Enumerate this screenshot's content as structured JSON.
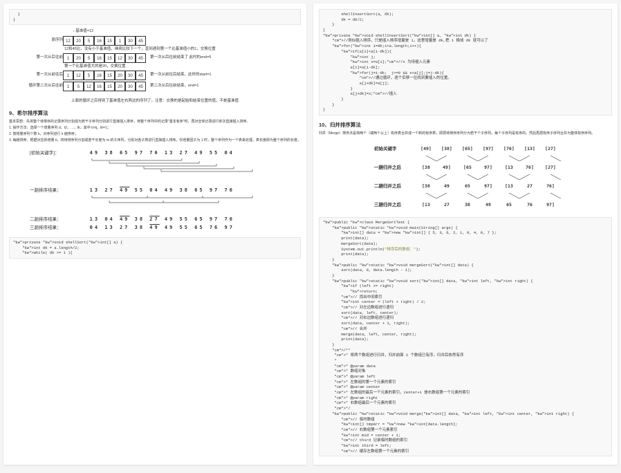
{
  "left_page": {
    "code_top": "  }\n}",
    "quicksort": {
      "pivot_label": "基准值=12",
      "rows": [
        {
          "label": "原序列",
          "cells": [
            "12",
            "20",
            "5",
            "16",
            "15",
            "1",
            "30",
            "45"
          ],
          "note": ""
        },
        {
          "desc": "12和45比，没有小于基准值，继续比较下一个，直到遇到第一个比基准值小的1，交换位置"
        },
        {
          "label": "第一次从后往前",
          "cells": [
            "1",
            "20",
            "5",
            "16",
            "15",
            "12",
            "30",
            "45"
          ],
          "note": "第一次从后往前结束了    此时的end=5"
        },
        {
          "desc": "第一个比基准值大的是20，交换位置"
        },
        {
          "label": "第一次从前往后",
          "cells": [
            "1",
            "12",
            "5",
            "16",
            "15",
            "20",
            "30",
            "45"
          ],
          "note": "第一次从前往后结束，此时的start=1"
        },
        {
          "label": "循环第二次从后往前",
          "cells": [
            "1",
            "5",
            "12",
            "16",
            "15",
            "20",
            "30",
            "45"
          ],
          "note": "第二次从后往前结束，end=1"
        }
      ],
      "summary": "上面的循环之后得到了基准值左右两边的序列了。注意：交换的是起始和结束位置的值，不是基准值"
    },
    "section9_title": "9、希尔排序算法",
    "section9_desc": "基本思想：先将整个待排序的记录序列分割成为若干子序列分别进行直接插入排序，待整个序列中的记录\"基本有序\"时，再对全体记录进行依次直接插入排序。",
    "section9_steps": [
      "1. 操作方法：选择一个增量序列 d，t2，…，tk，其中 ti>tj，tk=1；",
      "2. 按增量序列个数 k，对序列进行 k 趟排序；",
      "3. 每趟排序，根据对应的增量 ti，将待排序列分割成若干长度为 m 的子序列，分别对各子表进行直接插入排序。仅增量因子为 1 时，整个序列作为一个表来处理，表长度即为整个序列的长度。"
    ],
    "shell": {
      "init_label": "[初始关键字]：",
      "init": "49  38  65  97  76  13  27  49  55  04",
      "pass1_label": "一趟排序结果：",
      "pass1": "13  27  49  55  04  49  38  65  97  76",
      "pass2_label": "二趟排序结果：",
      "pass2": "13  04  49  38  27  49  55  65  97  76",
      "pass3_label": "三趟排序结果：",
      "pass3": "04  13  27  38  49  49  55  65  76  97"
    },
    "code_bottom_lines": [
      "private void shellSort(int[] a) {",
      "    int dk = a.length/2;",
      "    while( dk >= 1 ){"
    ]
  },
  "right_page": {
    "code_top_lines": [
      "        shellInsertSort(a, dk);",
      "        dk = dk/2;",
      "    }",
      "}",
      "private void shellInsertSort(int[] a, int dk) {",
      "    //类似插入排序，只是插入排序增量是 1，这里增量是 dk,把 1 换成 dk 就可以了",
      "    for(int i=dk;i<a.length;i++){",
      "        if(a[i]<a[i-dk]){",
      "            int j;",
      "            int x=a[i];//x 为待插入元素",
      "            a[i]=a[i-dk];",
      "            for(j=i-dk;  j>=0 && x<a[j];j=j-dk){",
      "                //通过循环，逐个后移一位找到要插入的位置。",
      "                a[j+dk]=a[j];",
      "            }",
      "            a[j+dk]=x;//插入",
      "        }",
      "    }",
      "}"
    ],
    "section10_title": "10、归并排序算法",
    "section10_desc": "归并（Merge）排序法是将两个（或两个以上）有序表合并成一个新的有序表，即把待排序序列分为若干个子序列，每个子序列是有序的。然后再把有序子序列合并为整体有序序列。",
    "merge": {
      "rows": [
        {
          "label": "初始关键字",
          "vals": [
            "[49]",
            "[38]",
            "[65]",
            "[97]",
            "[76]",
            "[13]",
            "[27]"
          ]
        },
        {
          "label": "一趟归并之后",
          "vals": [
            "[38",
            "49]",
            "[65",
            "97]",
            "[13",
            "76]",
            "[27]"
          ]
        },
        {
          "label": "二趟归并之后",
          "vals": [
            "[38",
            "49",
            "65",
            "97]",
            "[13",
            "27",
            "76]"
          ]
        },
        {
          "label": "三趟归并之后",
          "vals": [
            "[13",
            "27",
            "38",
            "49",
            "65",
            "76",
            "97]"
          ]
        }
      ]
    },
    "code_merge_lines": [
      "public class MergeSortTest {",
      "    public static void main(String[] args) {",
      "        int[] data = new int[] { 5, 3, 6, 2, 1, 9, 4, 8, 7 };",
      "        print(data);",
      "        mergeSort(data);",
      "        System.out.println(\"排序后的数组：\");",
      "        print(data);",
      "    }",
      "    public static void mergeSort(int[] data) {",
      "        sort(data, 0, data.length - 1);",
      "    }",
      "    public static void sort(int[] data, int left, int right) {",
      "        if (left >= right)",
      "            return;",
      "        // 找出中间索引",
      "        int center = (left + right) / 2;",
      "        // 对左边数组进行递归",
      "        sort(data, left, center);",
      "        // 对右边数组进行递归",
      "        sort(data, center + 1, right);",
      "        // 合并",
      "        merge(data, left, center, right);",
      "        print(data);",
      "    }",
      "    /**",
      "     * 将两个数组进行归并，归并前面 2 个数组已有序，归并后依然有序",
      "     *",
      "     * @param data",
      "     * 数组对象",
      "     * @param left",
      "     * 左数组的第一个元素的索引",
      "     * @param center",
      "     * 左数组的最后一个元素的索引，center+1 是右数组第一个元素的索引",
      "     * @param right",
      "     * 右数组最后一个元素的索引",
      "     */",
      "    public static void merge(int[] data, int left, int center, int right) {",
      "        // 临时数组",
      "        int[] tmpArr = new int[data.length];",
      "        // 右数组第一个元素索引",
      "        int mid = center + 1;",
      "        // third 记录临时数组的索引",
      "        int third = left;",
      "        // 缓存左数组第一个元素的索引"
    ]
  }
}
